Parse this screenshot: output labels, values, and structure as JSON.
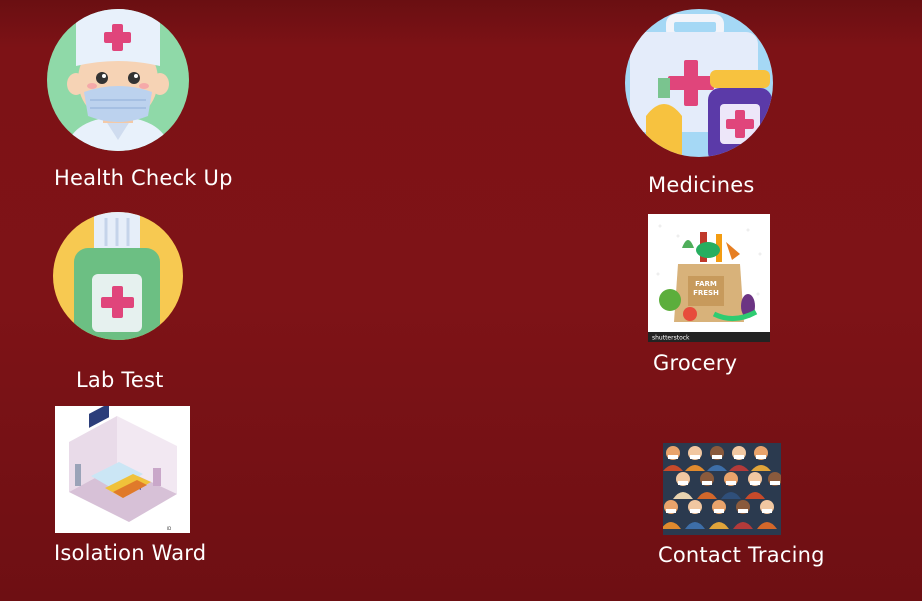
{
  "tiles": {
    "health_check_up": {
      "label": "Health Check Up",
      "icon": "doctor-icon"
    },
    "medicines": {
      "label": "Medicines",
      "icon": "medicine-bottles-icon"
    },
    "lab_test": {
      "label": "Lab Test",
      "icon": "lab-bottle-icon"
    },
    "grocery": {
      "label": "Grocery",
      "icon": "grocery-bag-icon",
      "image_text": [
        "FARM",
        "FRESH"
      ],
      "watermark": "shutterstock"
    },
    "isolation_ward": {
      "label": "Isolation Ward",
      "icon": "hospital-room-icon"
    },
    "contact_tracing": {
      "label": "Contact Tracing",
      "icon": "crowd-masks-icon"
    }
  },
  "colors": {
    "background": "#7e1317",
    "label_text": "#ffffff",
    "medical_cross": "#e0457b"
  }
}
